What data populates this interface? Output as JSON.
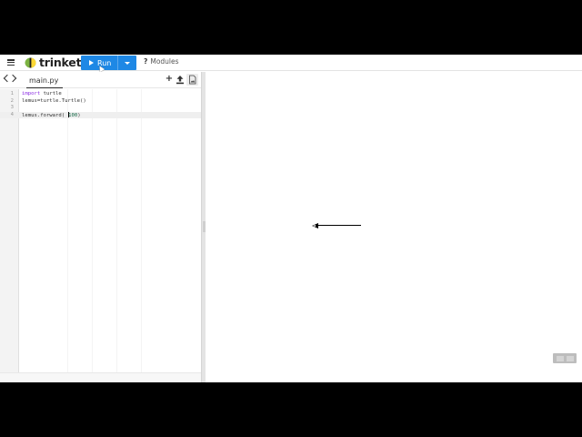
{
  "toolbar": {
    "logo_text": "trinket",
    "run_label": "Run",
    "modules_label": "Modules",
    "modules_prefix": "?"
  },
  "editor": {
    "active_file": "main.py",
    "lines": [
      {
        "num": "1",
        "parts": [
          [
            "kw",
            "import"
          ],
          [
            "txt",
            " turtle"
          ]
        ]
      },
      {
        "num": "2",
        "parts": [
          [
            "txt",
            "lemus=turtle.Turtle()"
          ]
        ]
      },
      {
        "num": "3",
        "parts": []
      },
      {
        "num": "4",
        "parts": [
          [
            "txt",
            "lemus.forward( "
          ],
          [
            "cursor",
            ""
          ],
          [
            "num",
            "100"
          ],
          [
            "txt",
            ")"
          ]
        ],
        "active": true
      }
    ]
  },
  "canvas": {
    "turtle_heading": "left",
    "line_length_units": 100
  },
  "colors": {
    "run_button": "#1e88e5",
    "logo_green": "#7cb342",
    "logo_yellow": "#fdd835"
  },
  "icons": [
    "menu-icon",
    "trinket-logo",
    "play-icon",
    "chevron-down-icon",
    "question-icon",
    "chevron-left-icon",
    "chevron-right-icon",
    "plus-icon",
    "upload-icon",
    "file-image-icon"
  ]
}
